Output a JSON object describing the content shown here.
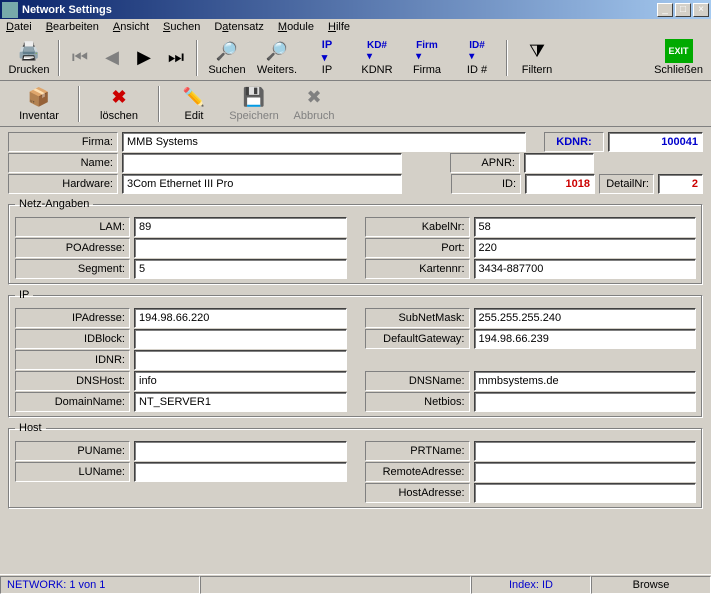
{
  "window": {
    "title": "Network Settings"
  },
  "menu": {
    "datei": "Datei",
    "bearbeiten": "Bearbeiten",
    "ansicht": "Ansicht",
    "suchen": "Suchen",
    "datensatz": "Datensatz",
    "module": "Module",
    "hilfe": "Hilfe"
  },
  "toolbar1": {
    "drucken": "Drucken",
    "suchen": "Suchen",
    "weiters": "Weiters.",
    "ip": "IP",
    "kdnr": "KDNR",
    "firma": "Firma",
    "idnum": "ID #",
    "filtern": "Filtern",
    "schliessen": "Schließen"
  },
  "toolbar2": {
    "inventar": "Inventar",
    "loeschen": "löschen",
    "edit": "Edit",
    "speichern": "Speichern",
    "abbruch": "Abbruch"
  },
  "labels": {
    "firma": "Firma:",
    "kdnr": "KDNR:",
    "name": "Name:",
    "apnr": "APNR:",
    "hardware": "Hardware:",
    "id": "ID:",
    "detailnr": "DetailNr:",
    "netz": "Netz-Angaben",
    "lam": "LAM:",
    "kabelnr": "KabelNr:",
    "poadresse": "POAdresse:",
    "port": "Port:",
    "segment": "Segment:",
    "kartennr": "Kartennr:",
    "ip": "IP",
    "ipadresse": "IPAdresse:",
    "subnetmask": "SubNetMask:",
    "idblock": "IDBlock:",
    "defaultgateway": "DefaultGateway:",
    "idnr": "IDNR:",
    "dnshost": "DNSHost:",
    "dnsname": "DNSName:",
    "domainname": "DomainName:",
    "netbios": "Netbios:",
    "host": "Host",
    "puname": "PUName:",
    "prtname": "PRTName:",
    "luname": "LUName:",
    "remoteadresse": "RemoteAdresse:",
    "hostadresse": "HostAdresse:"
  },
  "values": {
    "firma": "MMB Systems",
    "kdnr": "100041",
    "name": "",
    "apnr": "",
    "hardware": "3Com Ethernet III Pro",
    "id": "1018",
    "detailnr": "2",
    "lam": "89",
    "kabelnr": "58",
    "poadresse": "",
    "port": "220",
    "segment": "5",
    "kartennr": "3434-887700",
    "ipadresse": "194.98.66.220",
    "subnetmask": "255.255.255.240",
    "idblock": "",
    "defaultgateway": "194.98.66.239",
    "idnr": "",
    "dnshost": "info",
    "dnsname": "mmbsystems.de",
    "domainname": "NT_SERVER1",
    "netbios": "",
    "puname": "",
    "prtname": "",
    "luname": "",
    "remoteadresse": "",
    "hostadresse": ""
  },
  "status": {
    "record": "NETWORK: 1  von  1",
    "index": "Index: ID",
    "mode": "Browse"
  }
}
